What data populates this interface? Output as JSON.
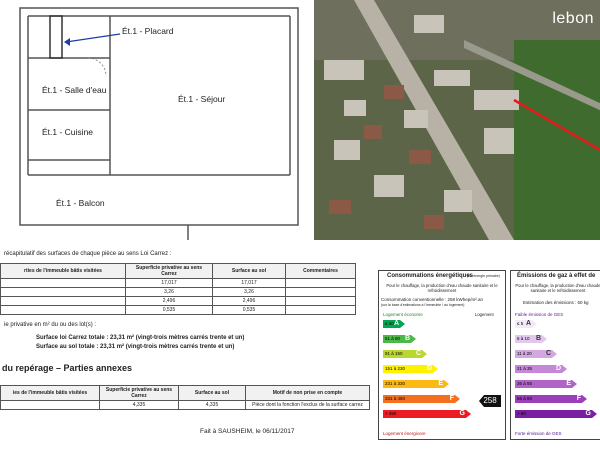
{
  "floor_plan": {
    "rooms": {
      "placard": "Ét.1 - Placard",
      "salle_deau": "Ét.1 - Salle d'eau",
      "sejour": "Ét.1 - Séjour",
      "cuisine": "Ét.1 - Cuisine",
      "balcon": "Ét.1 - Balcon"
    }
  },
  "aerial": {
    "brand": "lebon"
  },
  "surfaces": {
    "intro": "récapitulatif des surfaces de chaque pièce au sens Loi Carrez :",
    "headers": [
      "rties de l'immeuble bâtis visitées",
      "Superficie privative au sens Carrez",
      "Surface au sol",
      "Commentaires"
    ],
    "rows": [
      [
        "",
        "17,017",
        "17,017",
        ""
      ],
      [
        "",
        "3,26",
        "3,26",
        ""
      ],
      [
        "",
        "2,496",
        "2,496",
        ""
      ],
      [
        "",
        "0,535",
        "0,535",
        ""
      ]
    ],
    "lot_title": "ie privative en m² du ou des lot(s) :",
    "carrez_total": "Surface loi Carrez totale : 23,31 m² (vingt-trois mètres carrés trente et un)",
    "sol_total": "Surface au sol totale : 23,31 m² (vingt-trois mètres carrés trente et un)",
    "annexes_title": "du repérage – Parties annexes",
    "annexes_headers": [
      "ies de l'immeuble bâtis visitées",
      "Superficie privative au sens Carrez",
      "Surface au sol",
      "Motif de non prise en compte"
    ],
    "annexes_row": [
      "",
      "4,335",
      "4,335",
      "Pièce dont la fonction l'exclus de la surface carrez"
    ],
    "signature": "Fait à SAUSHEIM, le 06/11/2017"
  },
  "energy": {
    "conso_title": "Consommations énergétiques",
    "conso_sub": "(En énergie primaire)",
    "conso_desc": "Pour le chauffage, la production d'eau chaude sanitaire et le refroidissement",
    "conso_line": "Consommation conventionnelle : 258 kWhep/m².an",
    "conso_line2": "(sur la base d'estimations à l'immeuble / au logement)",
    "top_label": "Logement économe",
    "logement_label": "Logement",
    "bottom_label": "Logement énergivore",
    "value": "258",
    "ges_title": "Émissions de gaz à effet de",
    "ges_desc": "Pour le chauffage, la production d'eau chaude sanitaire et le refroidissement",
    "ges_line": "Estimation des émissions : 60 kg",
    "ges_top": "Faible émission de GES",
    "ges_bottom": "Forte émission de GES",
    "dpe_bands": [
      {
        "range": "≤ 50",
        "letter": "A",
        "color": "#00a651"
      },
      {
        "range": "51 à 90",
        "letter": "B",
        "color": "#4cb848"
      },
      {
        "range": "91 à 150",
        "letter": "C",
        "color": "#bcd631"
      },
      {
        "range": "151 à 230",
        "letter": "D",
        "color": "#fff200"
      },
      {
        "range": "231 à 330",
        "letter": "E",
        "color": "#fdb913"
      },
      {
        "range": "331 à 450",
        "letter": "F",
        "color": "#f37021"
      },
      {
        "range": "> 450",
        "letter": "G",
        "color": "#ed1c24"
      }
    ],
    "ges_bands": [
      {
        "range": "≤ 5",
        "letter": "A",
        "color": "#f4e9f6"
      },
      {
        "range": "6 à 10",
        "letter": "B",
        "color": "#e2c8ec"
      },
      {
        "range": "11 à 20",
        "letter": "C",
        "color": "#d3a8e0"
      },
      {
        "range": "21 à 35",
        "letter": "D",
        "color": "#c488d6"
      },
      {
        "range": "36 à 55",
        "letter": "E",
        "color": "#b164c8"
      },
      {
        "range": "56 à 80",
        "letter": "F",
        "color": "#9a40b8"
      },
      {
        "range": "> 80",
        "letter": "G",
        "color": "#7b1fa2"
      }
    ]
  }
}
